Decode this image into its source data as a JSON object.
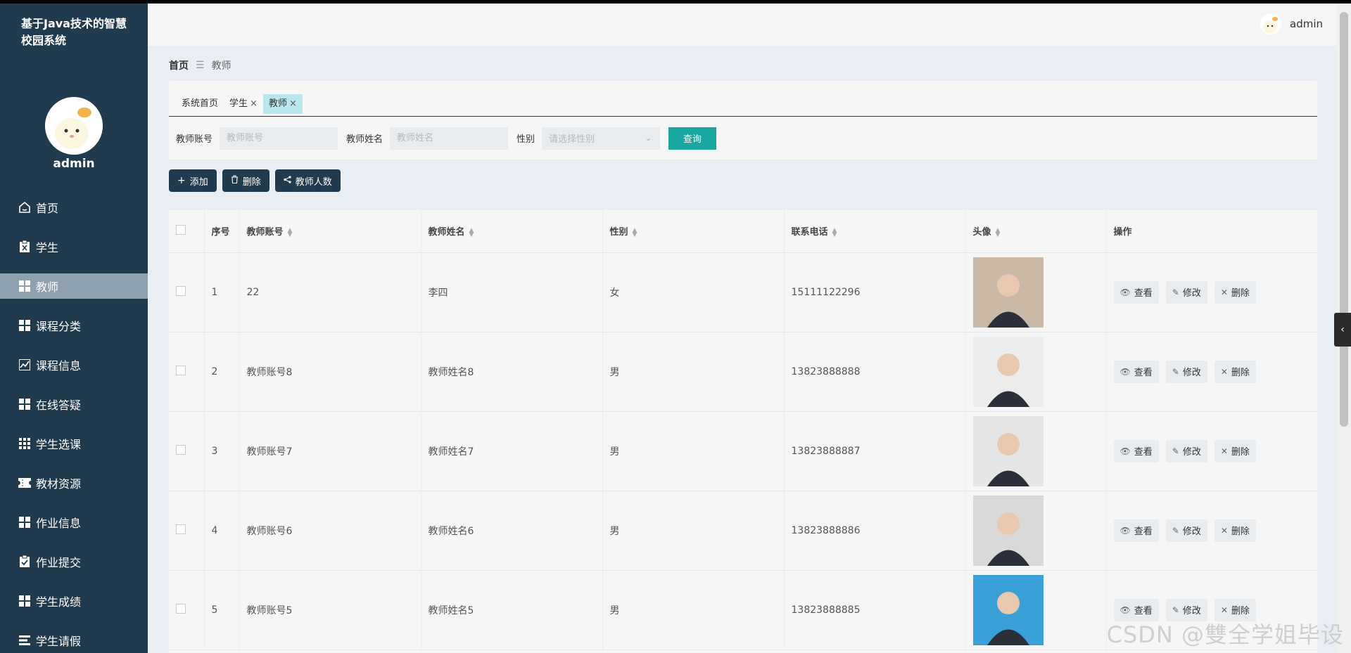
{
  "app": {
    "title": "基于Java技术的智慧校园系统"
  },
  "sidebar": {
    "username": "admin",
    "items": [
      {
        "label": "首页",
        "icon": "home-icon"
      },
      {
        "label": "学生",
        "icon": "clipboard-x-icon"
      },
      {
        "label": "教师",
        "icon": "grid-icon",
        "active": true
      },
      {
        "label": "课程分类",
        "icon": "grid-icon"
      },
      {
        "label": "课程信息",
        "icon": "chart-icon"
      },
      {
        "label": "在线答疑",
        "icon": "grid-icon"
      },
      {
        "label": "学生选课",
        "icon": "grid-9-icon"
      },
      {
        "label": "教材资源",
        "icon": "ticket-icon"
      },
      {
        "label": "作业信息",
        "icon": "grid-icon"
      },
      {
        "label": "作业提交",
        "icon": "clipboard-check-icon"
      },
      {
        "label": "学生成绩",
        "icon": "grid-icon"
      },
      {
        "label": "学生请假",
        "icon": "list-icon"
      }
    ]
  },
  "header": {
    "username": "admin"
  },
  "breadcrumb": {
    "home": "首页",
    "current": "教师"
  },
  "tabs": [
    {
      "label": "系统首页",
      "closable": false
    },
    {
      "label": "学生",
      "closable": true
    },
    {
      "label": "教师",
      "closable": true,
      "active": true
    }
  ],
  "search": {
    "account_label": "教师账号",
    "account_placeholder": "教师账号",
    "name_label": "教师姓名",
    "name_placeholder": "教师姓名",
    "gender_label": "性别",
    "gender_placeholder": "请选择性别",
    "query_button": "查询"
  },
  "actions": {
    "add": "添加",
    "delete": "删除",
    "count": "教师人数"
  },
  "table": {
    "headers": {
      "index": "序号",
      "account": "教师账号",
      "name": "教师姓名",
      "gender": "性别",
      "phone": "联系电话",
      "avatar": "头像",
      "ops": "操作"
    },
    "op_labels": {
      "view": "查看",
      "edit": "修改",
      "delete": "删除"
    },
    "rows": [
      {
        "index": "1",
        "account": "22",
        "name": "李四",
        "gender": "女",
        "phone": "15111122296",
        "photo_bg": "#c9b9a6"
      },
      {
        "index": "2",
        "account": "教师账号8",
        "name": "教师姓名8",
        "gender": "男",
        "phone": "13823888888",
        "photo_bg": "#ececec"
      },
      {
        "index": "3",
        "account": "教师账号7",
        "name": "教师姓名7",
        "gender": "男",
        "phone": "13823888887",
        "photo_bg": "#e6e6e6"
      },
      {
        "index": "4",
        "account": "教师账号6",
        "name": "教师姓名6",
        "gender": "男",
        "phone": "13823888886",
        "photo_bg": "#d9d9d9"
      },
      {
        "index": "5",
        "account": "教师账号5",
        "name": "教师姓名5",
        "gender": "男",
        "phone": "13823888885",
        "photo_bg": "#3aa0d8"
      }
    ]
  },
  "watermark": "CSDN @雙全学姐毕设"
}
